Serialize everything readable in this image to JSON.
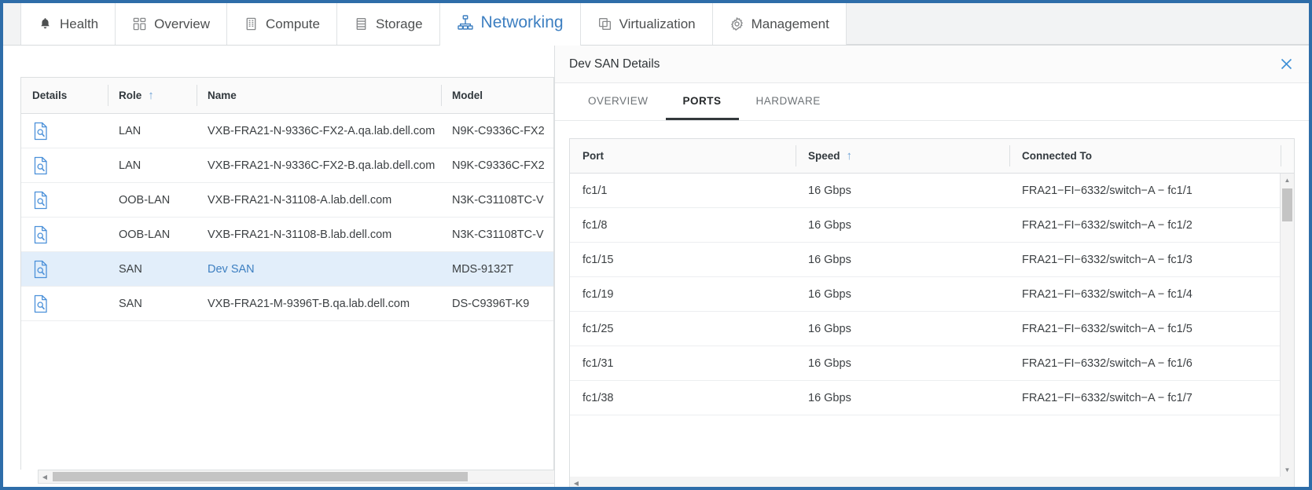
{
  "window": {
    "border_color": "#2e6da9",
    "accent_color": "#3d7fc1"
  },
  "tabs": [
    {
      "label": "Health",
      "icon": "bell-icon",
      "active": false
    },
    {
      "label": "Overview",
      "icon": "grid-icon",
      "active": false
    },
    {
      "label": "Compute",
      "icon": "server-icon",
      "active": false
    },
    {
      "label": "Storage",
      "icon": "storage-stack-icon",
      "active": false
    },
    {
      "label": "Networking",
      "icon": "network-tree-icon",
      "active": true
    },
    {
      "label": "Virtualization",
      "icon": "copy-window-icon",
      "active": false
    },
    {
      "label": "Management",
      "icon": "gear-icon",
      "active": false
    }
  ],
  "device_grid": {
    "columns": [
      {
        "label": "Details",
        "sorted": false,
        "sort_dir": ""
      },
      {
        "label": "Role",
        "sorted": true,
        "sort_dir": "↑"
      },
      {
        "label": "Name",
        "sorted": false,
        "sort_dir": ""
      },
      {
        "label": "Model",
        "sorted": false,
        "sort_dir": ""
      }
    ],
    "details_icon": "document-search-icon",
    "rows": [
      {
        "role": "LAN",
        "name": "VXB-FRA21-N-9336C-FX2-A.qa.lab.dell.com",
        "model": "N9K-C9336C-FX2",
        "selected": false,
        "name_is_link": false
      },
      {
        "role": "LAN",
        "name": "VXB-FRA21-N-9336C-FX2-B.qa.lab.dell.com",
        "model": "N9K-C9336C-FX2",
        "selected": false,
        "name_is_link": false
      },
      {
        "role": "OOB-LAN",
        "name": "VXB-FRA21-N-31108-A.lab.dell.com",
        "model": "N3K-C31108TC-V",
        "selected": false,
        "name_is_link": false
      },
      {
        "role": "OOB-LAN",
        "name": "VXB-FRA21-N-31108-B.lab.dell.com",
        "model": "N3K-C31108TC-V",
        "selected": false,
        "name_is_link": false
      },
      {
        "role": "SAN",
        "name": "Dev SAN",
        "model": "MDS-9132T",
        "selected": true,
        "name_is_link": true
      },
      {
        "role": "SAN",
        "name": "VXB-FRA21-M-9396T-B.qa.lab.dell.com",
        "model": "DS-C9396T-K9",
        "selected": false,
        "name_is_link": false
      }
    ]
  },
  "detail_panel": {
    "title": "Dev SAN Details",
    "close_icon": "close-icon",
    "tabs": [
      {
        "label": "OVERVIEW",
        "active": false
      },
      {
        "label": "PORTS",
        "active": true
      },
      {
        "label": "HARDWARE",
        "active": false
      }
    ],
    "ports_grid": {
      "columns": [
        {
          "label": "Port",
          "sorted": false,
          "sort_dir": ""
        },
        {
          "label": "Speed",
          "sorted": true,
          "sort_dir": "↑"
        },
        {
          "label": "Connected To",
          "sorted": false,
          "sort_dir": ""
        }
      ],
      "rows": [
        {
          "port": "fc1/1",
          "speed": "16 Gbps",
          "connected_to": "FRA21−FI−6332/switch−A − fc1/1"
        },
        {
          "port": "fc1/8",
          "speed": "16 Gbps",
          "connected_to": "FRA21−FI−6332/switch−A − fc1/2"
        },
        {
          "port": "fc1/15",
          "speed": "16 Gbps",
          "connected_to": "FRA21−FI−6332/switch−A − fc1/3"
        },
        {
          "port": "fc1/19",
          "speed": "16 Gbps",
          "connected_to": "FRA21−FI−6332/switch−A − fc1/4"
        },
        {
          "port": "fc1/25",
          "speed": "16 Gbps",
          "connected_to": "FRA21−FI−6332/switch−A − fc1/5"
        },
        {
          "port": "fc1/31",
          "speed": "16 Gbps",
          "connected_to": "FRA21−FI−6332/switch−A − fc1/6"
        },
        {
          "port": "fc1/38",
          "speed": "16 Gbps",
          "connected_to": "FRA21−FI−6332/switch−A − fc1/7"
        }
      ]
    }
  },
  "scrollbars": {
    "up_arrow": "▲",
    "down_arrow": "▼",
    "left_arrow": "◀",
    "right_arrow": "▶"
  }
}
